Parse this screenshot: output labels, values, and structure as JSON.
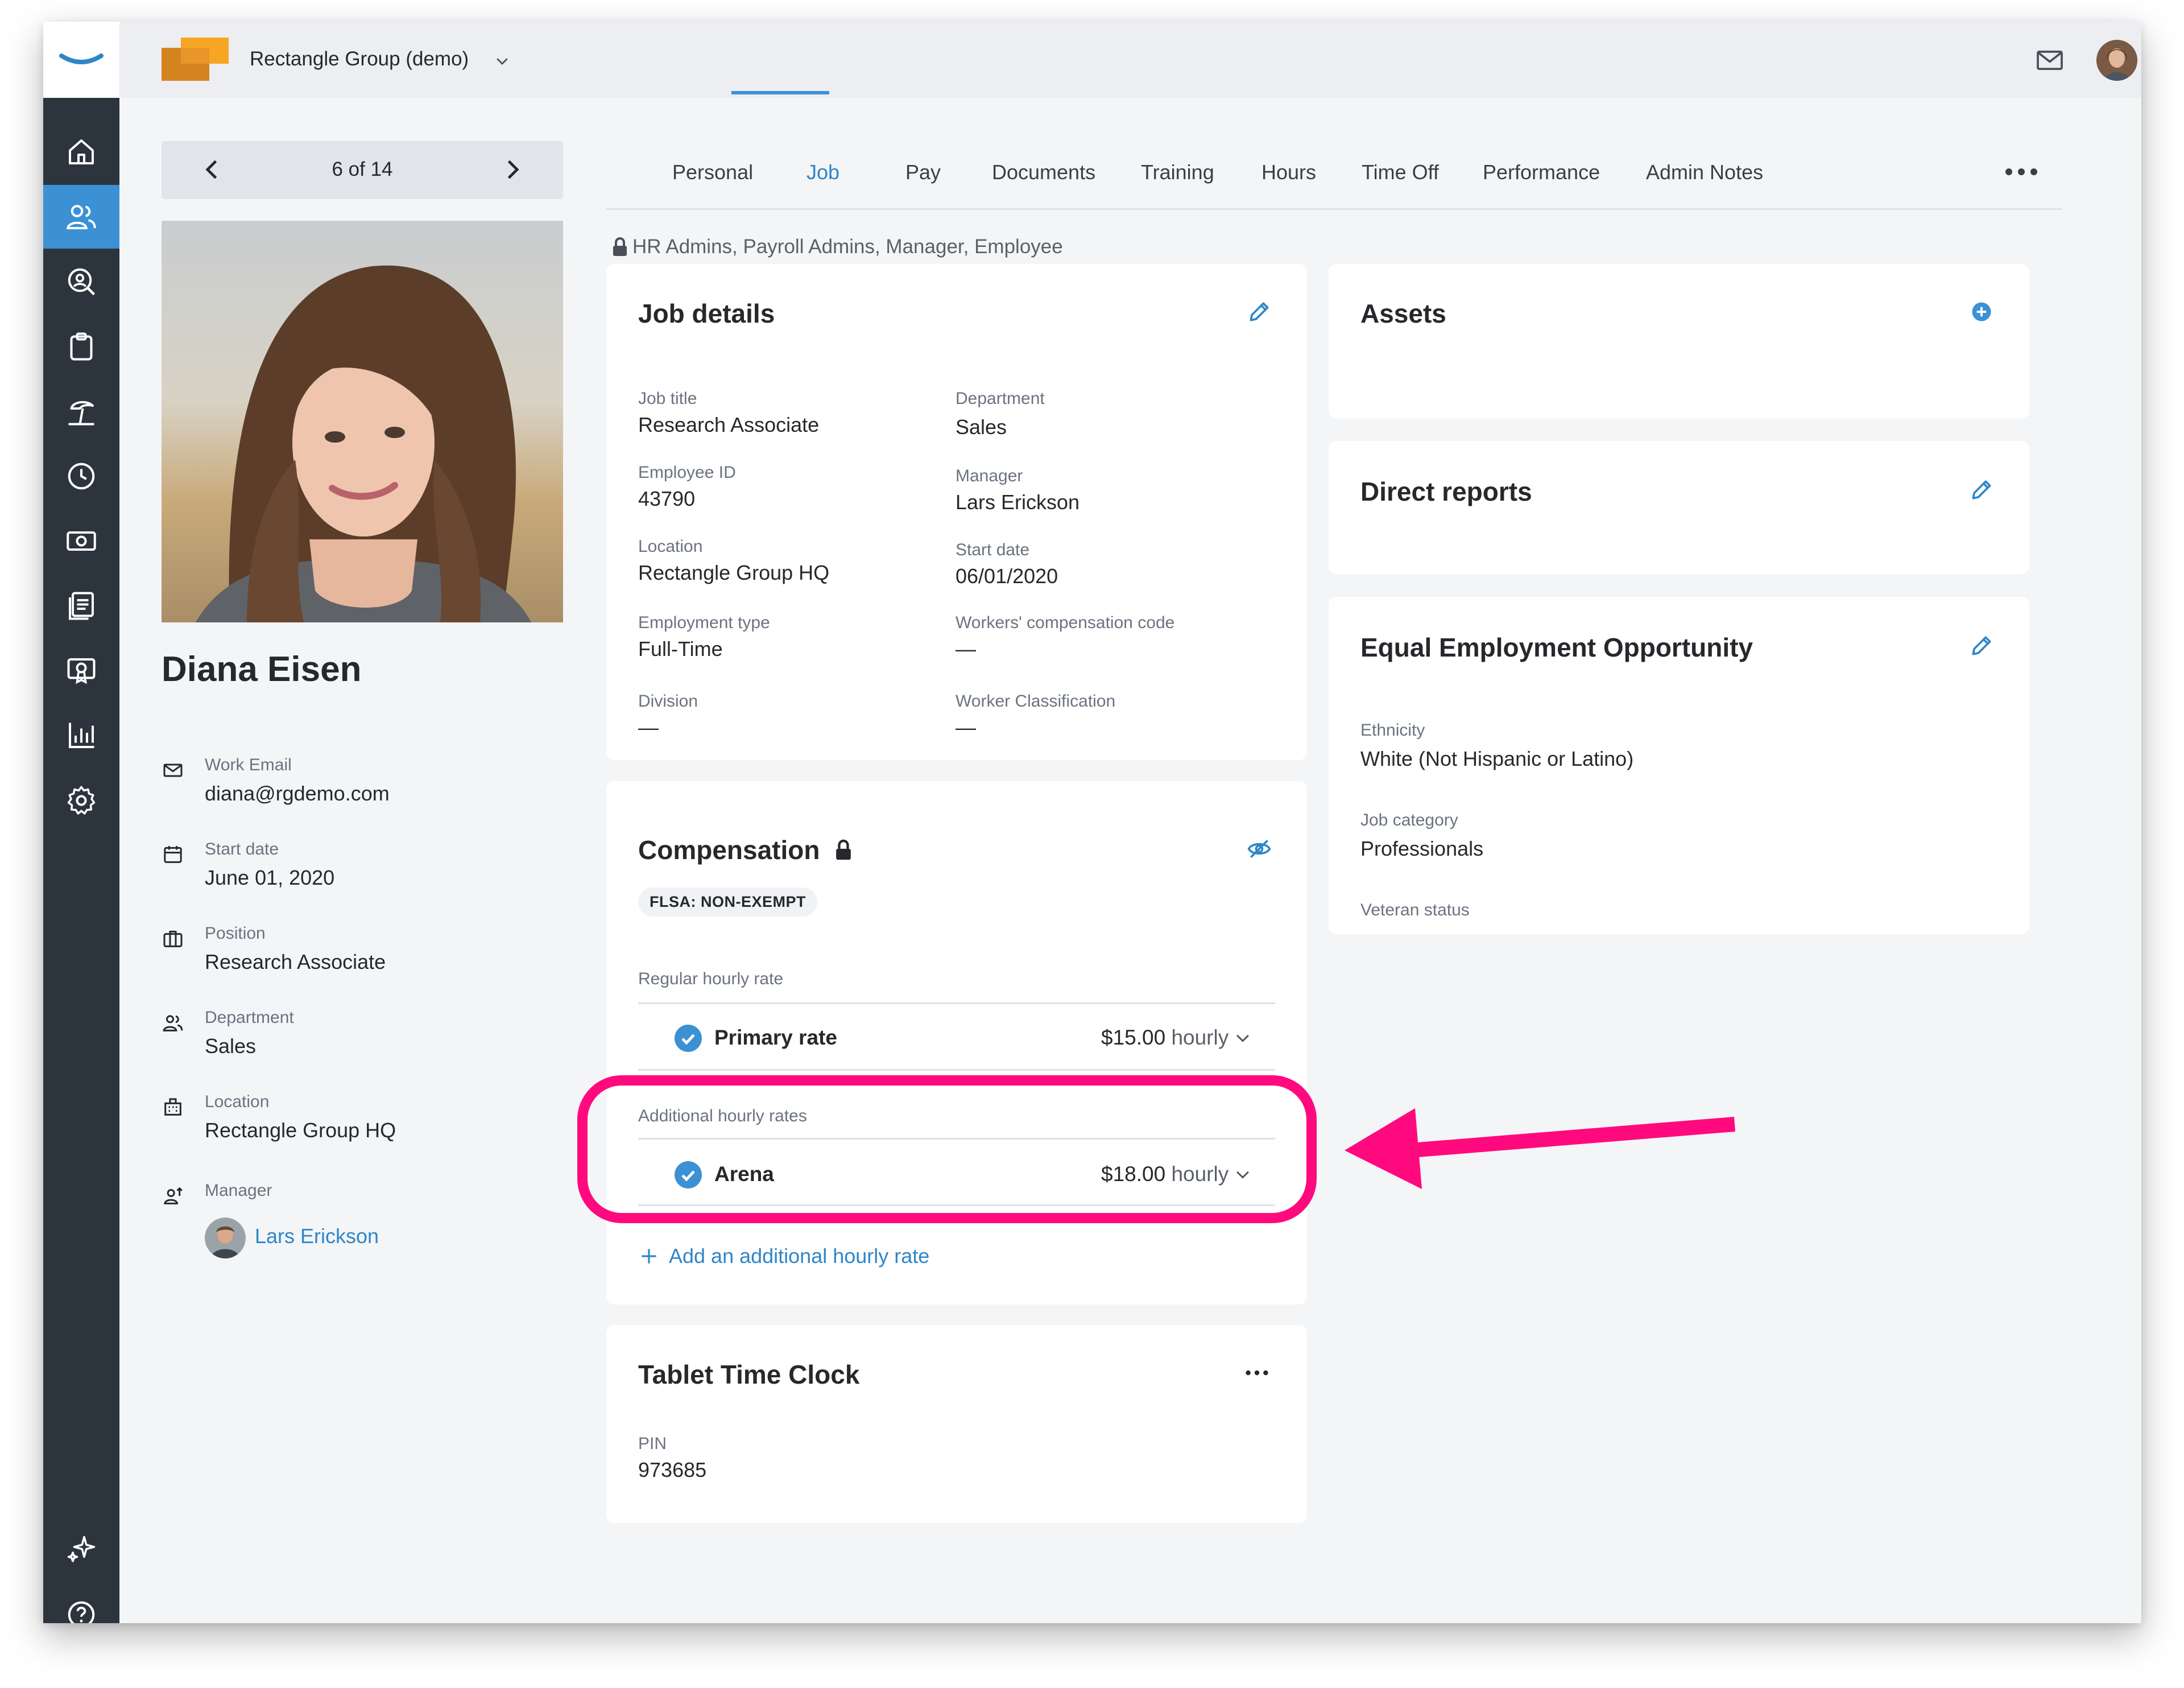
{
  "topbar": {
    "org_name": "Rectangle Group (demo)",
    "icons": [
      "org-logo-icon",
      "chevron-down-icon",
      "mail-icon",
      "user-avatar",
      "chevron-down-icon"
    ]
  },
  "sidebar": {
    "icons": [
      "home-icon",
      "people-icon",
      "search-person-icon",
      "clipboard-icon",
      "beach-icon",
      "clock-icon",
      "money-icon",
      "reports-icon",
      "certificate-icon",
      "bar-chart-icon",
      "gear-icon",
      "sparkle-icon",
      "help-icon"
    ],
    "active_index": 1
  },
  "pager": {
    "count": "6 of 14"
  },
  "profile": {
    "name": "Diana Eisen",
    "fields": [
      {
        "label": "Work Email",
        "value": "diana@rgdemo.com",
        "icon": "mail-icon"
      },
      {
        "label": "Start date",
        "value": "June 01, 2020",
        "icon": "calendar-icon"
      },
      {
        "label": "Position",
        "value": "Research Associate",
        "icon": "briefcase-icon"
      },
      {
        "label": "Department",
        "value": "Sales",
        "icon": "people-icon"
      },
      {
        "label": "Location",
        "value": "Rectangle Group HQ",
        "icon": "building-icon"
      },
      {
        "label": "Manager",
        "value": "Lars Erickson",
        "icon": "manager-icon"
      }
    ]
  },
  "tabs": [
    "Personal",
    "Job",
    "Pay",
    "Documents",
    "Training",
    "Hours",
    "Time Off",
    "Performance",
    "Admin Notes"
  ],
  "active_tab": "Job",
  "access_text": "HR Admins, Payroll Admins, Manager, Employee",
  "job_details": {
    "title": "Job details",
    "left": [
      {
        "label": "Job title",
        "value": "Research Associate"
      },
      {
        "label": "Employee ID",
        "value": "43790"
      },
      {
        "label": "Location",
        "value": "Rectangle Group HQ"
      },
      {
        "label": "Employment type",
        "value": "Full-Time"
      },
      {
        "label": "Division",
        "value": "—"
      }
    ],
    "right": [
      {
        "label": "Department",
        "value": "Sales"
      },
      {
        "label": "Manager",
        "value": "Lars Erickson"
      },
      {
        "label": "Start date",
        "value": "06/01/2020"
      },
      {
        "label": "Workers' compensation code",
        "value": "—"
      },
      {
        "label": "Worker Classification",
        "value": "—"
      }
    ]
  },
  "compensation": {
    "title": "Compensation",
    "flsa": "FLSA: NON-EXEMPT",
    "regular_label": "Regular hourly rate",
    "primary": {
      "name": "Primary rate",
      "amount": "$15.00",
      "unit": "hourly"
    },
    "additional_label": "Additional hourly rates",
    "additional": {
      "name": "Arena",
      "amount": "$18.00",
      "unit": "hourly"
    },
    "add_link": "Add an additional hourly rate"
  },
  "tablet_clock": {
    "title": "Tablet Time Clock",
    "pin_label": "PIN",
    "pin_value": "973685"
  },
  "assets": {
    "title": "Assets"
  },
  "direct_reports": {
    "title": "Direct reports"
  },
  "eeo": {
    "title": "Equal Employment Opportunity",
    "fields": [
      {
        "label": "Ethnicity",
        "value": "White (Not Hispanic or Latino)"
      },
      {
        "label": "Job category",
        "value": "Professionals"
      },
      {
        "label": "Veteran status",
        "value": ""
      }
    ]
  },
  "colors": {
    "accent": "#3b91d3",
    "sidebar": "#2c343d",
    "highlight": "#ff0a7e",
    "link": "#2e86c8"
  }
}
